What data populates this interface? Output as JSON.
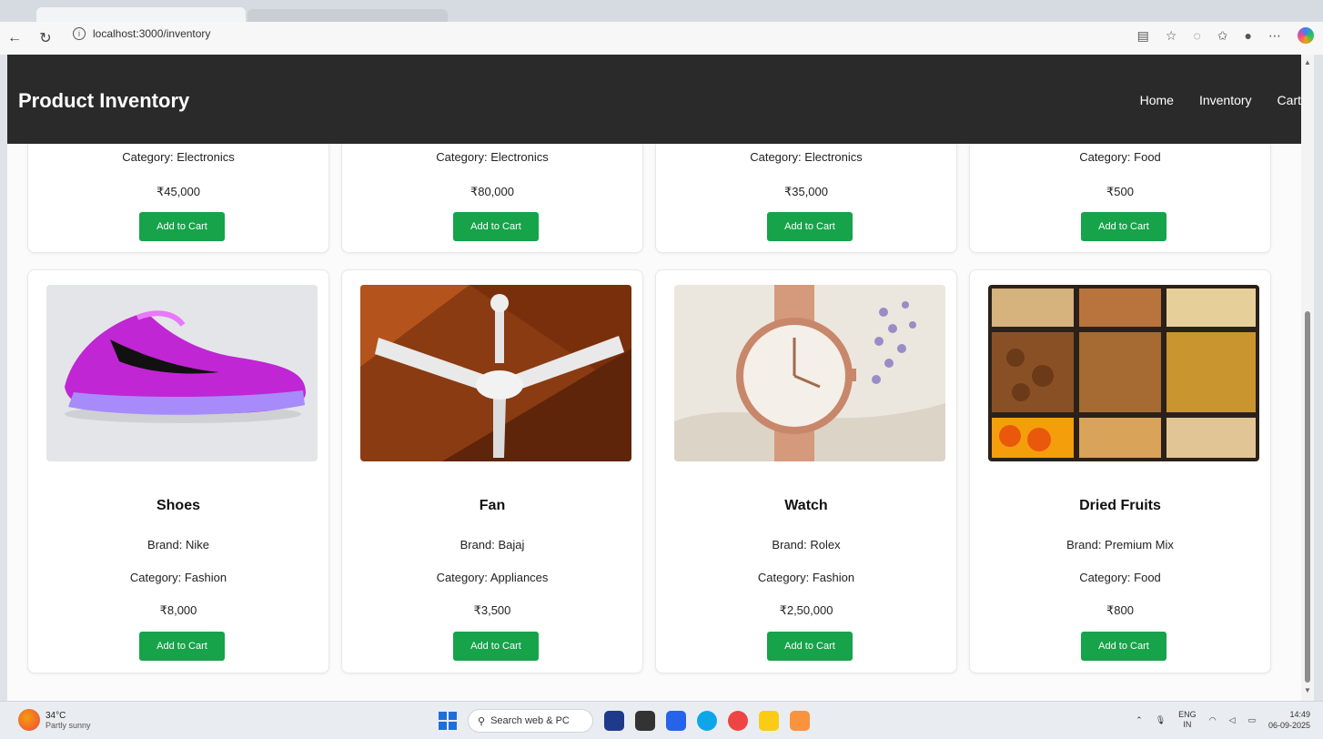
{
  "browser": {
    "url": "localhost:3000/inventory"
  },
  "header": {
    "brand": "Product Inventory",
    "nav": [
      "Home",
      "Inventory",
      "Cart"
    ]
  },
  "top_row": [
    {
      "category": "Category: Electronics",
      "price": "₹45,000",
      "button": "Add to Cart"
    },
    {
      "category": "Category: Electronics",
      "price": "₹80,000",
      "button": "Add to Cart"
    },
    {
      "category": "Category: Electronics",
      "price": "₹35,000",
      "button": "Add to Cart"
    },
    {
      "category": "Category: Food",
      "price": "₹500",
      "button": "Add to Cart"
    }
  ],
  "products": [
    {
      "name": "Shoes",
      "brand": "Brand: Nike",
      "category": "Category: Fashion",
      "price": "₹8,000",
      "button": "Add to Cart",
      "image": "pink-sneaker-image"
    },
    {
      "name": "Fan",
      "brand": "Brand: Bajaj",
      "category": "Category: Appliances",
      "price": "₹3,500",
      "button": "Add to Cart",
      "image": "ceiling-fan-image"
    },
    {
      "name": "Watch",
      "brand": "Brand: Rolex",
      "category": "Category: Fashion",
      "price": "₹2,50,000",
      "button": "Add to Cart",
      "image": "wrist-watch-image"
    },
    {
      "name": "Dried Fruits",
      "brand": "Brand: Premium Mix",
      "category": "Category: Food",
      "price": "₹800",
      "button": "Add to Cart",
      "image": "dried-fruits-image"
    }
  ],
  "taskbar": {
    "temp": "34°C",
    "weather": "Partly sunny",
    "search": "Search web & PC",
    "lang": "ENG",
    "region": "IN",
    "time": "14:49",
    "date": "06-09-2025"
  },
  "colors": {
    "header": "#2a2a2a",
    "button": "#16a34a"
  }
}
